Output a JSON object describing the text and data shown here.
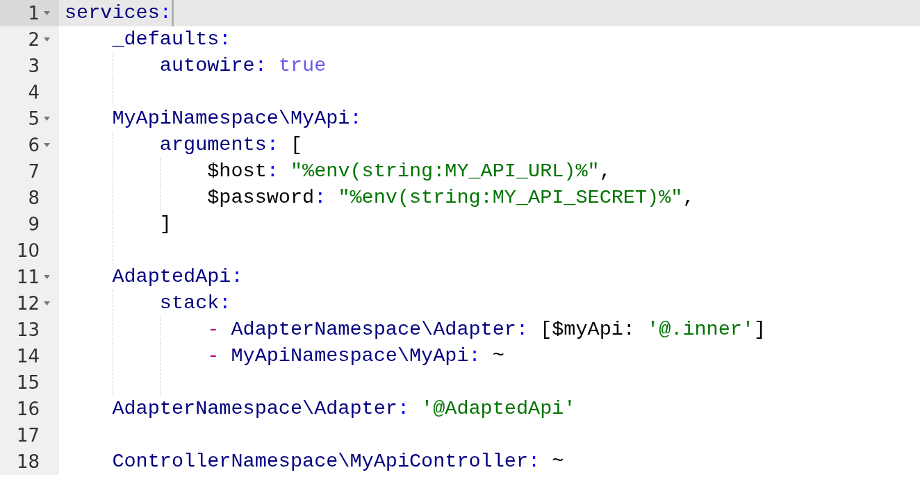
{
  "editor": {
    "lines": [
      {
        "number": "1",
        "foldable": true,
        "current": true,
        "tokens": [
          {
            "kind": "key",
            "text": "services"
          },
          {
            "kind": "colon",
            "text": ":"
          }
        ]
      },
      {
        "number": "2",
        "foldable": true,
        "current": false,
        "tokens": [
          {
            "kind": "key",
            "text": "    _defaults"
          },
          {
            "kind": "colon",
            "text": ":"
          }
        ]
      },
      {
        "number": "3",
        "foldable": false,
        "current": false,
        "tokens": [
          {
            "kind": "key",
            "text": "        autowire"
          },
          {
            "kind": "colon",
            "text": ": "
          },
          {
            "kind": "bool",
            "text": "true"
          }
        ]
      },
      {
        "number": "4",
        "foldable": false,
        "current": false
      },
      {
        "number": "5",
        "foldable": true,
        "current": false,
        "tokens": [
          {
            "kind": "key",
            "text": "    MyApiNamespace\\MyApi"
          },
          {
            "kind": "colon",
            "text": ":"
          }
        ]
      },
      {
        "number": "6",
        "foldable": true,
        "current": false,
        "tokens": [
          {
            "kind": "key",
            "text": "        arguments"
          },
          {
            "kind": "colon",
            "text": ": "
          },
          {
            "kind": "plain",
            "text": "["
          }
        ]
      },
      {
        "number": "7",
        "foldable": false,
        "current": false,
        "tokens": [
          {
            "kind": "plain",
            "text": "            $host"
          },
          {
            "kind": "colon",
            "text": ": "
          },
          {
            "kind": "string",
            "text": "\"%env(string:MY_API_URL)%\""
          },
          {
            "kind": "plain",
            "text": ","
          }
        ]
      },
      {
        "number": "8",
        "foldable": false,
        "current": false,
        "tokens": [
          {
            "kind": "plain",
            "text": "            $password"
          },
          {
            "kind": "colon",
            "text": ": "
          },
          {
            "kind": "string",
            "text": "\"%env(string:MY_API_SECRET)%\""
          },
          {
            "kind": "plain",
            "text": ","
          }
        ]
      },
      {
        "number": "9",
        "foldable": false,
        "current": false,
        "tokens": [
          {
            "kind": "plain",
            "text": "        ]"
          }
        ]
      },
      {
        "number": "10",
        "foldable": false,
        "current": false
      },
      {
        "number": "11",
        "foldable": true,
        "current": false,
        "tokens": [
          {
            "kind": "key",
            "text": "    AdaptedApi"
          },
          {
            "kind": "colon",
            "text": ":"
          }
        ]
      },
      {
        "number": "12",
        "foldable": true,
        "current": false,
        "tokens": [
          {
            "kind": "key",
            "text": "        stack"
          },
          {
            "kind": "colon",
            "text": ":"
          }
        ]
      },
      {
        "number": "13",
        "foldable": false,
        "current": false,
        "tokens": [
          {
            "kind": "dash",
            "text": "            -"
          },
          {
            "kind": "key",
            "text": " AdapterNamespace\\Adapter"
          },
          {
            "kind": "colon",
            "text": ": "
          },
          {
            "kind": "plain",
            "text": "[$myApi: "
          },
          {
            "kind": "string",
            "text": "'@.inner'"
          },
          {
            "kind": "plain",
            "text": "]"
          }
        ]
      },
      {
        "number": "14",
        "foldable": false,
        "current": false,
        "tokens": [
          {
            "kind": "dash",
            "text": "            -"
          },
          {
            "kind": "key",
            "text": " MyApiNamespace\\MyApi"
          },
          {
            "kind": "colon",
            "text": ": "
          },
          {
            "kind": "plain",
            "text": "~"
          }
        ]
      },
      {
        "number": "15",
        "foldable": false,
        "current": false
      },
      {
        "number": "16",
        "foldable": false,
        "current": false,
        "tokens": [
          {
            "kind": "key",
            "text": "    AdapterNamespace\\Adapter"
          },
          {
            "kind": "colon",
            "text": ": "
          },
          {
            "kind": "string",
            "text": "'@AdaptedApi'"
          }
        ]
      },
      {
        "number": "17",
        "foldable": false,
        "current": false
      },
      {
        "number": "18",
        "foldable": false,
        "current": false,
        "tokens": [
          {
            "kind": "key",
            "text": "    ControllerNamespace\\MyApiController"
          },
          {
            "kind": "colon",
            "text": ": "
          },
          {
            "kind": "plain",
            "text": "~"
          }
        ]
      }
    ]
  }
}
